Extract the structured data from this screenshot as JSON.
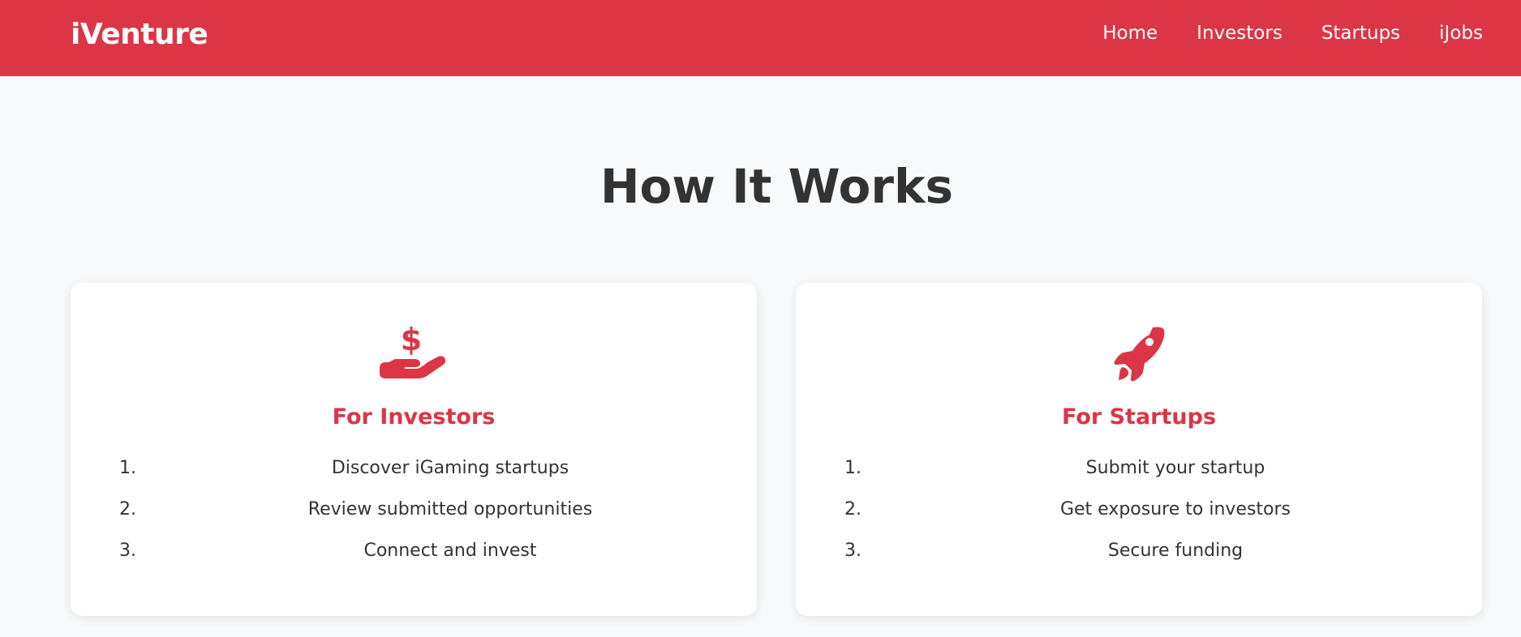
{
  "brand": {
    "name": "iVenture"
  },
  "nav": {
    "items": [
      {
        "label": "Home"
      },
      {
        "label": "Investors"
      },
      {
        "label": "Startups"
      },
      {
        "label": "iJobs"
      }
    ]
  },
  "how_it_works": {
    "title": "How It Works",
    "cards": [
      {
        "icon": "hand-holding-dollar-icon",
        "title": "For Investors",
        "steps": [
          {
            "num": "1.",
            "text": "Discover iGaming startups"
          },
          {
            "num": "2.",
            "text": "Review submitted opportunities"
          },
          {
            "num": "3.",
            "text": "Connect and invest"
          }
        ]
      },
      {
        "icon": "rocket-icon",
        "title": "For Startups",
        "steps": [
          {
            "num": "1.",
            "text": "Submit your startup"
          },
          {
            "num": "2.",
            "text": "Get exposure to investors"
          },
          {
            "num": "3.",
            "text": "Secure funding"
          }
        ]
      }
    ]
  },
  "colors": {
    "primary": "#dc3545",
    "background": "#f8f9fa",
    "text": "#333333",
    "card": "#ffffff"
  }
}
